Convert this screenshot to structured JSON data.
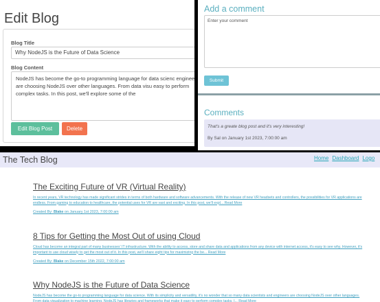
{
  "edit_blog": {
    "heading": "Edit Blog",
    "title_label": "Blog Title",
    "title_value": "Why NodeJS is the Future of Data Science",
    "content_label": "Blog Content",
    "content_value": "NodeJS has become the go-to programming language for data scienc engineers are choosing NodeJS over other languages. From data visu easy to perform complex tasks. In this post, we'll explore some of the",
    "edit_button": "Edit Blog Post",
    "delete_button": "Delete"
  },
  "comment_section": {
    "add_heading": "Add a comment",
    "comment_placeholder": "Enter your comment",
    "submit_button": "Submit",
    "comments_heading": "Comments",
    "comments": [
      {
        "text": "That's a greate blog post and it's very interesting!",
        "meta": "By Sal on January 1st 2023, 7:00:00 am"
      }
    ]
  },
  "home": {
    "site_title": "The Tech Blog",
    "nav": [
      "Home",
      "Dashboard",
      "Logo"
    ],
    "posts": [
      {
        "title": "The Exciting Future of VR (Virtual Reality)",
        "body": "In recent years, VR technology has made significant strides in terms of both hardware and software advancements. With the release of new VR headsets and controllers, the possibilities for VR applications are endless. From gaming to education to healthcare, the potential uses for VR are vast and exciting. In this post, we'll expl... Read More",
        "meta_prefix": "Created By:",
        "author": "Blake",
        "meta_suffix": "on January 1st 2023, 7:00:00 am"
      },
      {
        "title": "8 Tips for Getting the Most Out of using Cloud",
        "body": "Cloud has become an integral part of many businesses' IT infrastructure. With the ability to access, store and share data and applications from any device with internet access, it's easy to see why. However, it's important to use cloud wisely to get the most out of it. In this post, we'll share eight tips for maximizing the be... Read More",
        "meta_prefix": "Created By:",
        "author": "Blake",
        "meta_suffix": "on December 15th 2022, 7:00:00 am"
      },
      {
        "title": "Why NodeJS is the Future of Data Science",
        "body": "NodeJS has become the go-to programming language for data science. With its simplicity and versatility, it's no wonder that so many data scientists and engineers are choosing NodeJS over other languages. From data visualization to machine learning, NodeJS has libraries and frameworks that make it easy to perform complex tasks. I... Read More",
        "meta_prefix": "",
        "author": "",
        "meta_suffix": ""
      }
    ]
  }
}
